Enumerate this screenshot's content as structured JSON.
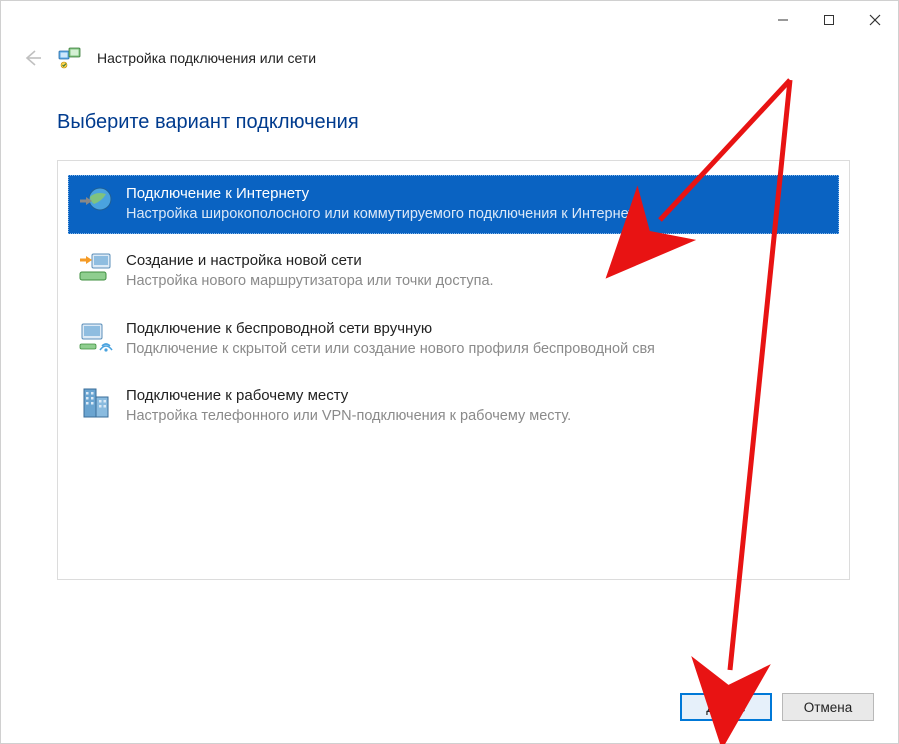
{
  "header": {
    "title": "Настройка подключения или сети"
  },
  "page": {
    "heading": "Выберите вариант подключения"
  },
  "options": [
    {
      "title": "Подключение к Интернету",
      "desc": "Настройка широкополосного или коммутируемого подключения к Интернету.",
      "selected": true
    },
    {
      "title": "Создание и настройка новой сети",
      "desc": "Настройка нового маршрутизатора или точки доступа."
    },
    {
      "title": "Подключение к беспроводной сети вручную",
      "desc": "Подключение к скрытой сети или создание нового профиля беспроводной свя"
    },
    {
      "title": "Подключение к рабочему месту",
      "desc": "Настройка телефонного или VPN-подключения к рабочему месту."
    }
  ],
  "footer": {
    "next": "Далее",
    "cancel": "Отмена"
  }
}
